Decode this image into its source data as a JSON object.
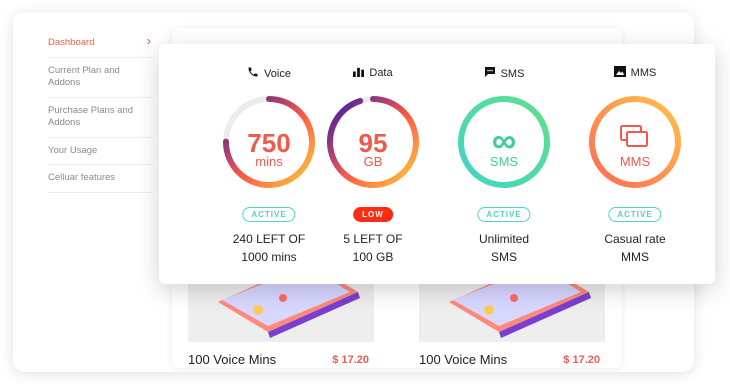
{
  "sidebar": {
    "items": [
      {
        "label": "Dashboard",
        "active": true
      },
      {
        "label": "Current Plan and Addons",
        "active": false
      },
      {
        "label": "Purchase Plans and Addons",
        "active": false
      },
      {
        "label": "Your Usage",
        "active": false
      },
      {
        "label": "Celluar features",
        "active": false
      }
    ],
    "chevron": "›"
  },
  "usage": [
    {
      "title": "Voice",
      "icon": "phone-icon",
      "value": "750",
      "unit": "mins",
      "badge": "ACTIVE",
      "badge_kind": "active",
      "line1": "240 LEFT OF",
      "line2": "1000 mins",
      "ring_fill": 0.75,
      "text_color": "#ef5a4c"
    },
    {
      "title": "Data",
      "icon": "bar-chart-icon",
      "value": "95",
      "unit": "GB",
      "badge": "LOW",
      "badge_kind": "low",
      "line1": "5 LEFT OF",
      "line2": "100 GB",
      "ring_fill": 0.95,
      "text_color": "#ef5a4c"
    },
    {
      "title": "SMS",
      "icon": "message-icon",
      "value": "∞",
      "unit": "SMS",
      "badge": "ACTIVE",
      "badge_kind": "active",
      "line1": "Unlimited",
      "line2": "SMS",
      "ring_fill": 1,
      "text_color": "#3fcf95"
    },
    {
      "title": "MMS",
      "icon": "image-icon",
      "value": "",
      "unit": "MMS",
      "badge": "ACTIVE",
      "badge_kind": "active",
      "line1": "Casual rate",
      "line2": "MMS",
      "ring_fill": 1,
      "text_color": "#ef5a4c"
    }
  ],
  "plans": [
    {
      "name": "100 Voice Mins",
      "price": "$ 17.20"
    },
    {
      "name": "100 Voice Mins",
      "price": "$ 17.20"
    }
  ],
  "colors": {
    "accent": "#ef5a4c",
    "active": "#4fd2c3",
    "low": "#ff2b14"
  }
}
